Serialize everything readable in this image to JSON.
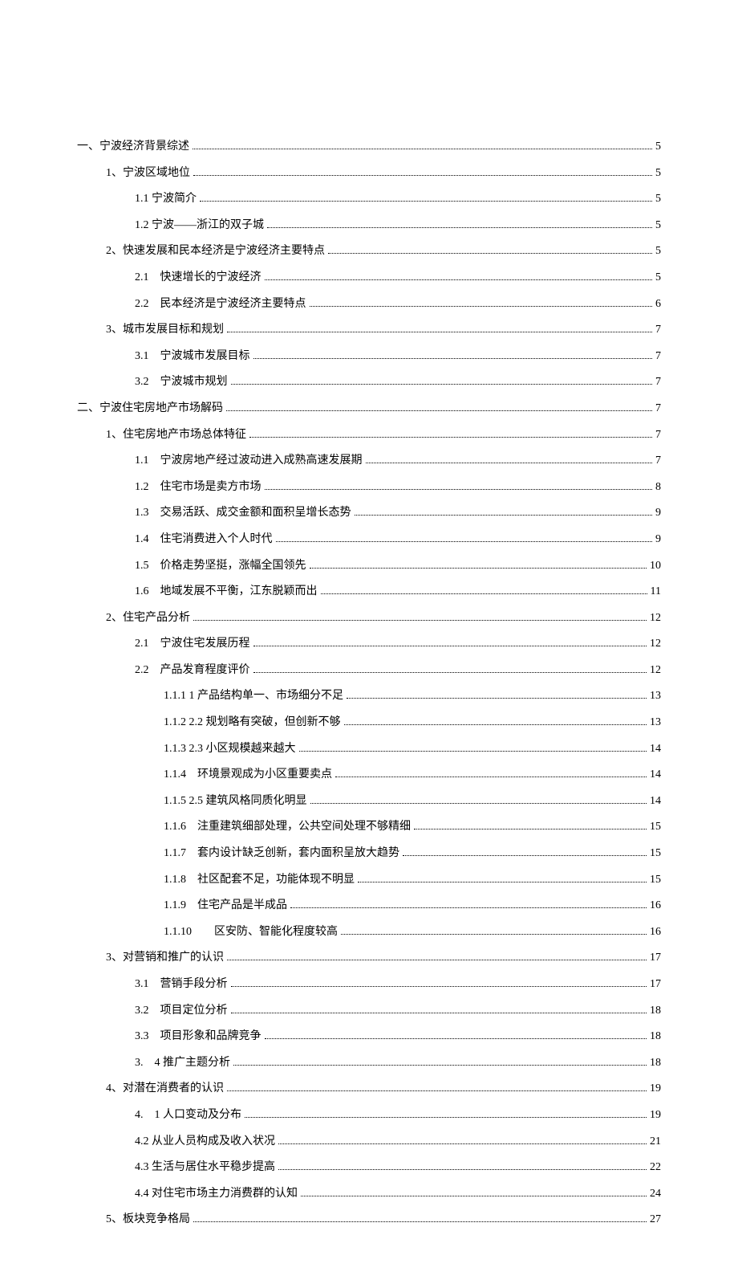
{
  "toc": [
    {
      "level": 0,
      "label": "一、宁波经济背景综述",
      "page": "5"
    },
    {
      "level": 1,
      "label": "1、宁波区域地位",
      "page": "5"
    },
    {
      "level": 2,
      "label": "1.1 宁波简介",
      "page": "5"
    },
    {
      "level": 2,
      "label": "1.2 宁波——浙江的双子城",
      "page": "5"
    },
    {
      "level": 1,
      "label": "2、快速发展和民本经济是宁波经济主要特点",
      "page": "5"
    },
    {
      "level": 2,
      "label": "2.1　快速增长的宁波经济",
      "page": "5"
    },
    {
      "level": 2,
      "label": "2.2　民本经济是宁波经济主要特点",
      "page": "6"
    },
    {
      "level": 1,
      "label": "3、城市发展目标和规划",
      "page": "7"
    },
    {
      "level": 2,
      "label": "3.1　宁波城市发展目标",
      "page": "7"
    },
    {
      "level": 2,
      "label": "3.2　宁波城市规划",
      "page": "7"
    },
    {
      "level": 0,
      "label": "二、宁波住宅房地产市场解码",
      "page": "7"
    },
    {
      "level": 1,
      "label": "1、住宅房地产市场总体特征",
      "page": "7"
    },
    {
      "level": 2,
      "label": "1.1　宁波房地产经过波动进入成熟高速发展期",
      "page": "7"
    },
    {
      "level": 2,
      "label": "1.2　住宅市场是卖方市场",
      "page": "8"
    },
    {
      "level": 2,
      "label": "1.3　交易活跃、成交金额和面积呈增长态势",
      "page": "9"
    },
    {
      "level": 2,
      "label": "1.4　住宅消费进入个人时代",
      "page": "9"
    },
    {
      "level": 2,
      "label": "1.5　价格走势坚挺，涨幅全国领先",
      "page": "10"
    },
    {
      "level": 2,
      "label": "1.6　地域发展不平衡，江东脱颖而出",
      "page": "11"
    },
    {
      "level": 1,
      "label": "2、住宅产品分析",
      "page": "12"
    },
    {
      "level": 2,
      "label": "2.1　宁波住宅发展历程",
      "page": "12"
    },
    {
      "level": 2,
      "label": "2.2　产品发育程度评价",
      "page": "12"
    },
    {
      "level": 3,
      "label": "1.1.1 1 产品结构单一、市场细分不足",
      "page": "13"
    },
    {
      "level": 3,
      "label": "1.1.2 2.2 规划略有突破，但创新不够",
      "page": "13"
    },
    {
      "level": 3,
      "label": "1.1.3 2.3 小区规模越来越大",
      "page": "14"
    },
    {
      "level": 3,
      "label": "1.1.4　环境景观成为小区重要卖点",
      "page": "14"
    },
    {
      "level": 3,
      "label": "1.1.5 2.5 建筑风格同质化明显",
      "page": "14"
    },
    {
      "level": 3,
      "label": "1.1.6　注重建筑细部处理，公共空间处理不够精细",
      "page": "15"
    },
    {
      "level": 3,
      "label": "1.1.7　套内设计缺乏创新，套内面积呈放大趋势",
      "page": "15"
    },
    {
      "level": 3,
      "label": "1.1.8　社区配套不足，功能体现不明显",
      "page": "15"
    },
    {
      "level": 3,
      "label": "1.1.9　住宅产品是半成品",
      "page": "16"
    },
    {
      "level": 3,
      "label": "1.1.10　　区安防、智能化程度较高",
      "page": "16"
    },
    {
      "level": 1,
      "label": "3、对营销和推广的认识",
      "page": "17"
    },
    {
      "level": 2,
      "label": "3.1　营销手段分析",
      "page": "17"
    },
    {
      "level": 2,
      "label": "3.2　项目定位分析",
      "page": "18"
    },
    {
      "level": 2,
      "label": "3.3　项目形象和品牌竞争",
      "page": "18"
    },
    {
      "level": 2,
      "label": "3.　4 推广主题分析",
      "page": "18"
    },
    {
      "level": 1,
      "label": "4、对潜在消费者的认识",
      "page": "19"
    },
    {
      "level": 2,
      "label": "4.　1 人口变动及分布",
      "page": "19"
    },
    {
      "level": 2,
      "label": "4.2 从业人员构成及收入状况",
      "page": "21"
    },
    {
      "level": 2,
      "label": "4.3 生活与居住水平稳步提高",
      "page": "22"
    },
    {
      "level": 2,
      "label": "4.4 对住宅市场主力消费群的认知",
      "page": "24"
    },
    {
      "level": 1,
      "label": "5、板块竞争格局",
      "page": "27"
    }
  ]
}
